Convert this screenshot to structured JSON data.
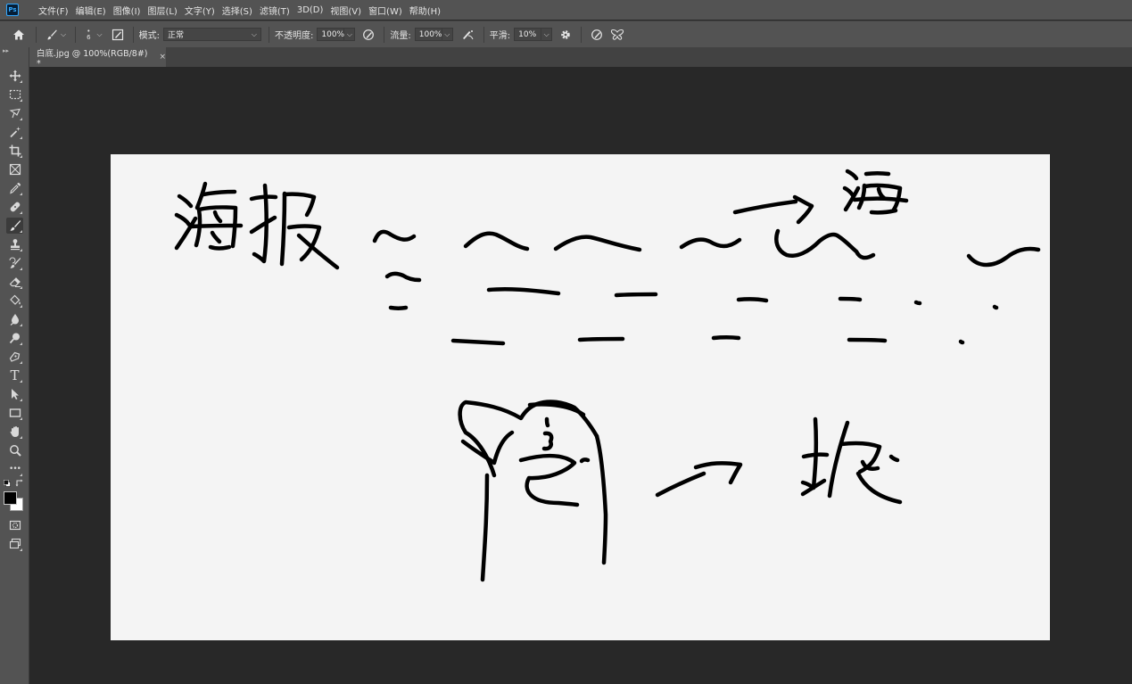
{
  "app": {
    "logo": "Ps"
  },
  "menu": [
    "文件(F)",
    "编辑(E)",
    "图像(I)",
    "图层(L)",
    "文字(Y)",
    "选择(S)",
    "滤镜(T)",
    "3D(D)",
    "视图(V)",
    "窗口(W)",
    "帮助(H)"
  ],
  "options": {
    "brush_size": "6",
    "mode_label": "模式:",
    "mode_value": "正常",
    "opacity_label": "不透明度:",
    "opacity_value": "100%",
    "flow_label": "流量:",
    "flow_value": "100%",
    "smoothing_label": "平滑:",
    "smoothing_value": "10%"
  },
  "document_tab": {
    "title": "白底.jpg @ 100%(RGB/8#) *",
    "close": "×"
  },
  "tools": [
    "move-tool-icon",
    "marquee-tool-icon",
    "lasso-tool-icon",
    "magic-wand-tool-icon",
    "crop-tool-icon",
    "frame-tool-icon",
    "eyedropper-tool-icon",
    "healing-brush-tool-icon",
    "brush-tool-icon",
    "clone-stamp-tool-icon",
    "history-brush-tool-icon",
    "eraser-tool-icon",
    "paint-bucket-tool-icon",
    "blur-tool-icon",
    "dodge-tool-icon",
    "pen-tool-icon",
    "type-tool-icon",
    "path-selection-tool-icon",
    "rectangle-tool-icon",
    "hand-tool-icon",
    "zoom-tool-icon",
    "edit-toolbar-icon"
  ],
  "type_tool_glyph": "T",
  "more_tools_glyph": "•••",
  "colors": {
    "foreground": "#000000",
    "background": "#ffffff",
    "canvas": "#f4f4f4",
    "workspace": "#282828",
    "panel": "#535353"
  },
  "sketch_text": {
    "line1": "海报",
    "line2_end": "海",
    "figure_right": "抱"
  }
}
